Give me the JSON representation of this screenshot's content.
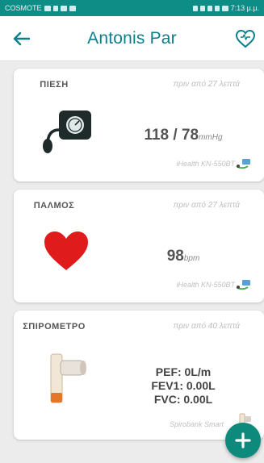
{
  "status_bar": {
    "carrier": "COSMOTE",
    "time": "7:13 μ.μ."
  },
  "app_bar": {
    "title": "Antonis Par",
    "back_icon": "arrow-left-icon",
    "heart_icon": "heart-outline-icon"
  },
  "colors": {
    "accent": "#0c7f8c",
    "status_bar": "#0d8d86",
    "fab": "#0e8a7d",
    "heart": "#e01b1b"
  },
  "cards": [
    {
      "title": "ΠΙΕΣΗ",
      "time": "πριν από 27 λεπτά",
      "value": "118 / 78",
      "unit": "mmHg",
      "device": "iHealth KN-550BT",
      "icon": "blood-pressure-monitor-icon"
    },
    {
      "title": "ΠΑΛΜΟΣ",
      "time": "πριν από 27 λεπτά",
      "value": "98",
      "unit": "bpm",
      "device": "iHealth KN-550BT",
      "icon": "heart-icon"
    },
    {
      "title": "ΣΠΙΡΟΜΕΤΡΟ",
      "time": "πριν από 40 λεπτά",
      "pef": "PEF: 0L/m",
      "fev1": "FEV1: 0.00L",
      "fvc": "FVC: 0.00L",
      "device": "Spirobank Smart",
      "icon": "spirometer-icon"
    }
  ],
  "fab": {
    "icon": "plus-icon"
  }
}
